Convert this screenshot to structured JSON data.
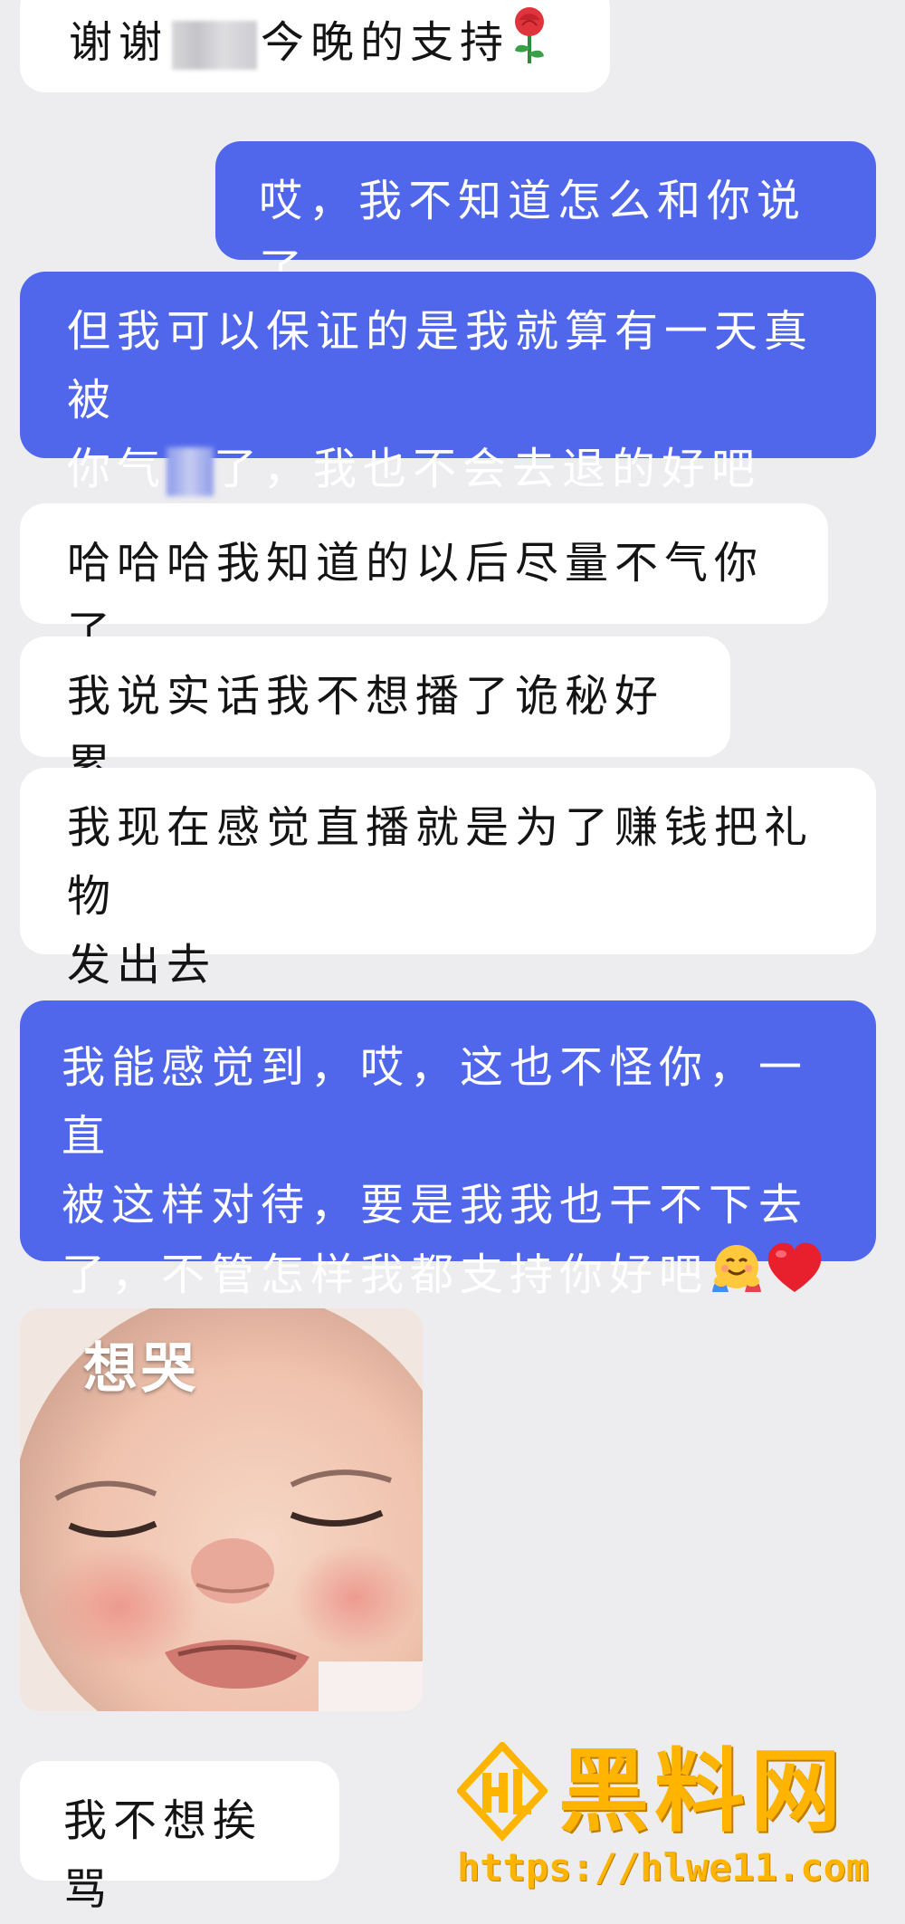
{
  "messages": [
    {
      "side": "incoming",
      "text_before": "谢谢",
      "text_after": "今晚的支持",
      "emoji": "rose-icon"
    },
    {
      "side": "outgoing",
      "text": "哎，我不知道怎么和你说了"
    },
    {
      "side": "outgoing",
      "line1": "但我可以保证的是我就算有一天真被",
      "line2_before": "你气",
      "line2_after": "了，我也不会去退的好吧"
    },
    {
      "side": "incoming",
      "text": "哈哈哈我知道的以后尽量不气你了"
    },
    {
      "side": "incoming",
      "text": "我说实话我不想播了诡秘好累"
    },
    {
      "side": "incoming",
      "line1": "我现在感觉直播就是为了赚钱把礼物",
      "line2": "发出去"
    },
    {
      "side": "outgoing",
      "line1": "我能感觉到，哎，这也不怪你，一直",
      "line2": "被这样对待，要是我我也干不下去",
      "line3": "了，不管怎样我都支持你好吧",
      "emojis": [
        "hugging-face-icon",
        "red-heart-icon"
      ]
    },
    {
      "side": "incoming",
      "sticker_caption": "想哭"
    },
    {
      "side": "incoming",
      "text": "我不想挨骂"
    }
  ],
  "watermark": {
    "brand": "黑料网",
    "url": "https://hlwe11.com",
    "logo": "hl-logo-icon"
  },
  "colors": {
    "background": "#ededf0",
    "incoming_bubble": "#ffffff",
    "outgoing_bubble": "#5067ec",
    "watermark": "#ffb400"
  }
}
